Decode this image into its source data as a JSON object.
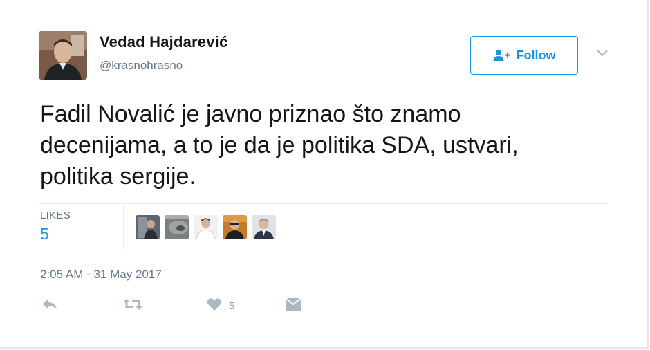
{
  "tweet": {
    "author_name": "Vedad Hajdarević",
    "author_handle": "@krasnohrasno",
    "follow_label": "Follow",
    "text": "Fadil Novalić je javno priznao što znamo decenijama, a to je da je politika SDA, ustvari, politika sergije.",
    "timestamp": "2:05 AM - 31 May 2017"
  },
  "stats": {
    "likes_label": "LIKES",
    "likes_count": "5"
  },
  "likers": [
    {
      "name": "liker-avatar-1"
    },
    {
      "name": "liker-avatar-2"
    },
    {
      "name": "liker-avatar-3"
    },
    {
      "name": "liker-avatar-4"
    },
    {
      "name": "liker-avatar-5"
    }
  ],
  "actions": {
    "like_count": "5"
  },
  "colors": {
    "accent": "#1b95e0",
    "secondary_text": "#657786",
    "icon_gray": "#aab8c2"
  },
  "icons": [
    "follow-user-icon",
    "dropdown-caret-icon",
    "reply-icon",
    "retweet-icon",
    "like-heart-icon",
    "direct-message-icon"
  ]
}
